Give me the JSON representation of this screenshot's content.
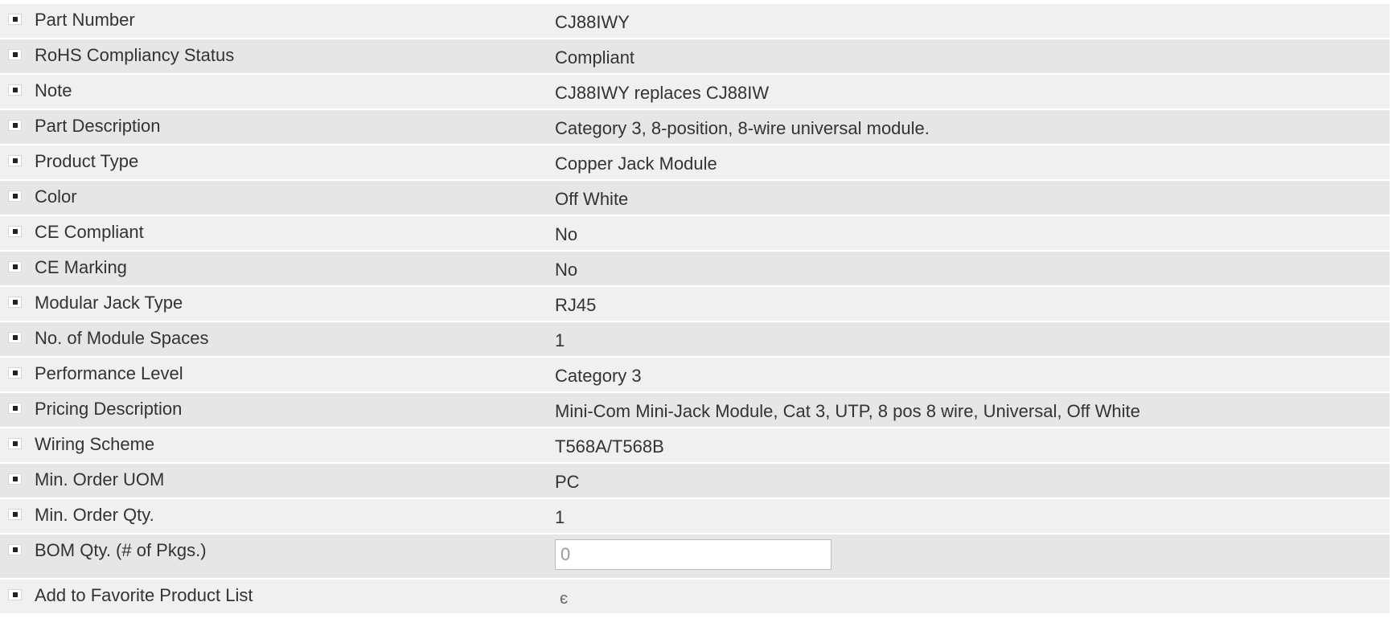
{
  "rows": [
    {
      "label": "Part Number",
      "value": "CJ88IWY"
    },
    {
      "label": "RoHS Compliancy Status",
      "value": "Compliant"
    },
    {
      "label": "Note",
      "value": "CJ88IWY replaces CJ88IW"
    },
    {
      "label": "Part Description",
      "value": "Category 3, 8-position, 8-wire universal module."
    },
    {
      "label": "Product Type",
      "value": "Copper Jack Module"
    },
    {
      "label": "Color",
      "value": "Off White"
    },
    {
      "label": "CE Compliant",
      "value": "No"
    },
    {
      "label": "CE Marking",
      "value": "No"
    },
    {
      "label": "Modular Jack Type",
      "value": "RJ45"
    },
    {
      "label": "No. of Module Spaces",
      "value": "1"
    },
    {
      "label": "Performance Level",
      "value": "Category 3"
    },
    {
      "label": "Pricing Description",
      "value": "Mini-Com Mini-Jack Module, Cat 3, UTP, 8 pos 8 wire, Universal, Off White"
    },
    {
      "label": "Wiring Scheme",
      "value": "T568A/T568B"
    },
    {
      "label": "Min. Order UOM",
      "value": "PC"
    },
    {
      "label": "Min. Order Qty.",
      "value": "1"
    }
  ],
  "bom": {
    "label": "BOM Qty. (# of Pkgs.)",
    "value": "0"
  },
  "favorite": {
    "label": "Add to Favorite Product List",
    "icon": "favorite-icon",
    "glyph": "є"
  },
  "colors": {
    "row_odd": "#f0f0f0",
    "row_even": "#e6e6e6",
    "text": "#333333"
  }
}
